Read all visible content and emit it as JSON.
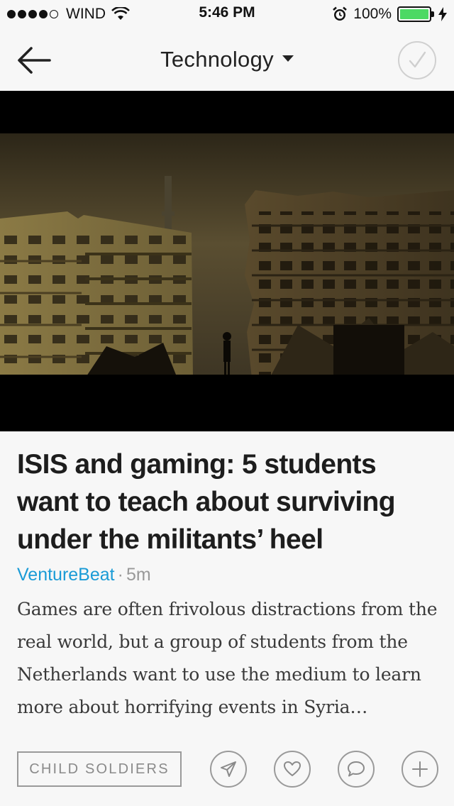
{
  "status_bar": {
    "carrier": "WIND",
    "time": "5:46 PM",
    "battery": "100%",
    "signal_bars_filled": 4,
    "signal_bars_total": 5,
    "icons": [
      "wifi-icon",
      "alarm-icon",
      "battery-icon",
      "charging-bolt-icon"
    ]
  },
  "nav": {
    "title": "Technology",
    "back_icon": "arrow-left-icon",
    "title_dropdown_icon": "caret-down-icon",
    "done_icon": "checkmark-icon"
  },
  "article": {
    "headline": "ISIS and gaming: 5 students want to teach about surviving under the militants’ heel",
    "source": "VentureBeat",
    "separator": "·",
    "age": "5m",
    "summary": "Games are often frivolous distractions from the real world, but a group of students from the Netherlands want to use the medium to learn more about horrifying events in Syria…"
  },
  "actions": {
    "tag": "CHILD SOLDIERS",
    "buttons": [
      "send-icon",
      "heart-icon",
      "comment-icon",
      "plus-icon"
    ]
  },
  "colors": {
    "accent": "#1a9bd6",
    "background": "#f7f7f7",
    "battery_fill": "#4cd964",
    "button_border": "#9a9a9a"
  }
}
